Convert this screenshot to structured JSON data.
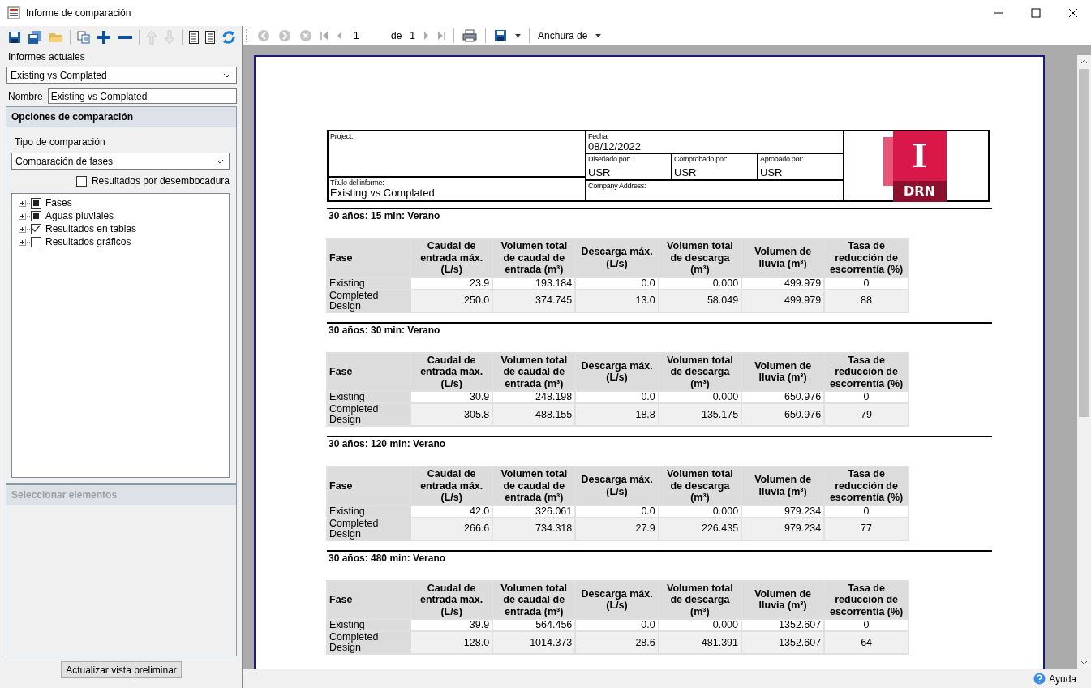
{
  "window": {
    "title": "Informe de comparación"
  },
  "left_toolbar": [
    {
      "kind": "save",
      "disabled": false
    },
    {
      "kind": "save-all",
      "disabled": false
    },
    {
      "kind": "open",
      "disabled": false
    },
    {
      "kind": "sep"
    },
    {
      "kind": "copy",
      "disabled": false
    },
    {
      "kind": "add",
      "disabled": false
    },
    {
      "kind": "remove",
      "disabled": false
    },
    {
      "kind": "sep"
    },
    {
      "kind": "up",
      "disabled": true
    },
    {
      "kind": "down",
      "disabled": true
    },
    {
      "kind": "sep"
    },
    {
      "kind": "doc",
      "disabled": false
    },
    {
      "kind": "doc2",
      "disabled": false
    },
    {
      "kind": "refresh",
      "disabled": false
    }
  ],
  "current_reports": {
    "label": "Informes actuales",
    "value": "Existing vs Complated"
  },
  "name_field": {
    "label": "Nombre",
    "value": "Existing vs Complated"
  },
  "options_panel": {
    "title": "Opciones de comparación",
    "type_label": "Tipo de comparación",
    "type_value": "Comparación de fases",
    "outfall_checkbox": {
      "label": "Resultados por desembocadura",
      "checked": false
    },
    "tree": [
      {
        "label": "Fases",
        "partial": true
      },
      {
        "label": "Aguas pluviales",
        "partial": true
      },
      {
        "label": "Resultados en tablas",
        "checked": true
      },
      {
        "label": "Resultados gráficos",
        "checked": false
      }
    ]
  },
  "select_panel": {
    "title": "Seleccionar elementos",
    "disabled": true
  },
  "update_button": "Actualizar vista preliminar",
  "viewer_toolbar": {
    "nav": [
      {
        "kind": "back",
        "disabled": true
      },
      {
        "kind": "forward",
        "disabled": true
      },
      {
        "kind": "stop",
        "disabled": true
      },
      {
        "kind": "first",
        "disabled": true
      },
      {
        "kind": "prev",
        "disabled": true
      }
    ],
    "page": "1",
    "of_label": "de",
    "total": "1",
    "nav2": [
      {
        "kind": "next",
        "disabled": true
      },
      {
        "kind": "last",
        "disabled": true
      }
    ],
    "zoom": "Anchura de"
  },
  "report_header": {
    "project_label": "Project:",
    "date_label": "Fecha:",
    "date": "08/12/2022",
    "designed_label": "Diseñado por:",
    "designed": "USR",
    "checked_label": "Comprobado por:",
    "checked": "USR",
    "approved_label": "Aprobado por:",
    "approved": "USR",
    "title_label": "Título del informe:",
    "title": "Existing vs Complated",
    "address_label": "Company Address:",
    "logo_letter": "I",
    "logo_text": "DRN"
  },
  "sections": [
    {
      "title": "30 años: 15 min: Verano",
      "columns": [
        "Fase",
        "Caudal de entrada máx. (L/s)",
        "Volumen total de caudal de entrada (m³)",
        "Descarga máx. (L/s)",
        "Volumen total de descarga (m³)",
        "Volumen de lluvia (m³)",
        "Tasa de reducción de escorrentía (%)"
      ],
      "rows": [
        [
          "Existing",
          "23.9",
          "193.184",
          "0.0",
          "0.000",
          "499.979",
          "0"
        ],
        [
          "Completed Design",
          "250.0",
          "374.745",
          "13.0",
          "58.049",
          "499.979",
          "88"
        ]
      ]
    },
    {
      "title": "30 años: 30 min: Verano",
      "columns": [
        "Fase",
        "Caudal de entrada máx. (L/s)",
        "Volumen total de caudal de entrada (m³)",
        "Descarga máx. (L/s)",
        "Volumen total de descarga (m³)",
        "Volumen de lluvia (m³)",
        "Tasa de reducción de escorrentía (%)"
      ],
      "rows": [
        [
          "Existing",
          "30.9",
          "248.198",
          "0.0",
          "0.000",
          "650.976",
          "0"
        ],
        [
          "Completed Design",
          "305.8",
          "488.155",
          "18.8",
          "135.175",
          "650.976",
          "79"
        ]
      ]
    },
    {
      "title": "30 años: 120 min: Verano",
      "columns": [
        "Fase",
        "Caudal de entrada máx. (L/s)",
        "Volumen total de caudal de entrada (m³)",
        "Descarga máx. (L/s)",
        "Volumen total de descarga (m³)",
        "Volumen de lluvia (m³)",
        "Tasa de reducción de escorrentía (%)"
      ],
      "rows": [
        [
          "Existing",
          "42.0",
          "326.061",
          "0.0",
          "0.000",
          "979.234",
          "0"
        ],
        [
          "Completed Design",
          "266.6",
          "734.318",
          "27.9",
          "226.435",
          "979.234",
          "77"
        ]
      ]
    },
    {
      "title": "30 años: 480 min: Verano",
      "columns": [
        "Fase",
        "Caudal de entrada máx. (L/s)",
        "Volumen total de caudal de entrada (m³)",
        "Descarga máx. (L/s)",
        "Volumen total de descarga (m³)",
        "Volumen de lluvia (m³)",
        "Tasa de reducción de escorrentía (%)"
      ],
      "rows": [
        [
          "Existing",
          "39.9",
          "564.456",
          "0.0",
          "0.000",
          "1352.607",
          "0"
        ],
        [
          "Completed Design",
          "128.0",
          "1014.373",
          "28.6",
          "481.391",
          "1352.607",
          "64"
        ]
      ]
    }
  ],
  "status_bar": {
    "help": "Ayuda"
  }
}
